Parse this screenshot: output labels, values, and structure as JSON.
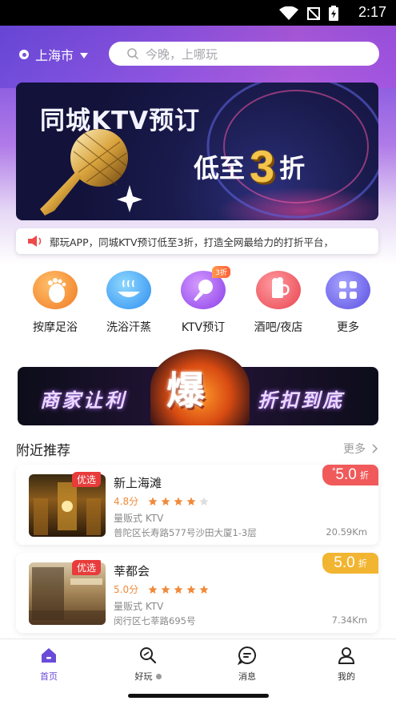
{
  "status_bar": {
    "time": "2:17"
  },
  "header": {
    "city": "上海市",
    "search_placeholder": "今晚，上哪玩"
  },
  "banner": {
    "title": "同城KTV预订",
    "subtitle_prefix": "低至",
    "subtitle_num": "3",
    "subtitle_suffix": "折"
  },
  "notice": {
    "text": "鄢玩APP，同城KTV预订低至3折，打造全网最给力的打折平台，"
  },
  "categories": [
    {
      "label": "按摩足浴",
      "icon": "foot-massage-icon"
    },
    {
      "label": "洗浴汗蒸",
      "icon": "bath-icon"
    },
    {
      "label": "KTV预订",
      "icon": "microphone-icon",
      "badge": "3折"
    },
    {
      "label": "酒吧/夜店",
      "icon": "beer-icon"
    },
    {
      "label": "更多",
      "icon": "grid-icon"
    }
  ],
  "promo": {
    "left": "商家让利",
    "center": "爆",
    "right": "折扣到底"
  },
  "nearby": {
    "title": "附近推荐",
    "more": "更多",
    "items": [
      {
        "badge": "优选",
        "name": "新上海滩",
        "rating": "4.8分",
        "stars": 4,
        "type": "量贩式 KTV",
        "address": "普陀区长寿路577号沙田大厦1-3层",
        "distance": "20.59Km",
        "discount": "5.0",
        "discount_unit": "折",
        "discount_prefix": "*",
        "discount_color": "#f05a5a"
      },
      {
        "badge": "优选",
        "name": "莘都会",
        "rating": "5.0分",
        "stars": 5,
        "type": "量贩式 KTV",
        "address": "闵行区七莘路695号",
        "distance": "7.34Km",
        "discount": "5.0",
        "discount_unit": "折",
        "discount_prefix": "",
        "discount_color": "#f2b531"
      }
    ]
  },
  "tabbar": [
    {
      "label": "首页",
      "icon": "home-icon",
      "active": true
    },
    {
      "label": "好玩",
      "icon": "explore-icon",
      "active": false
    },
    {
      "label": "消息",
      "icon": "message-icon",
      "active": false
    },
    {
      "label": "我的",
      "icon": "profile-icon",
      "active": false
    }
  ]
}
